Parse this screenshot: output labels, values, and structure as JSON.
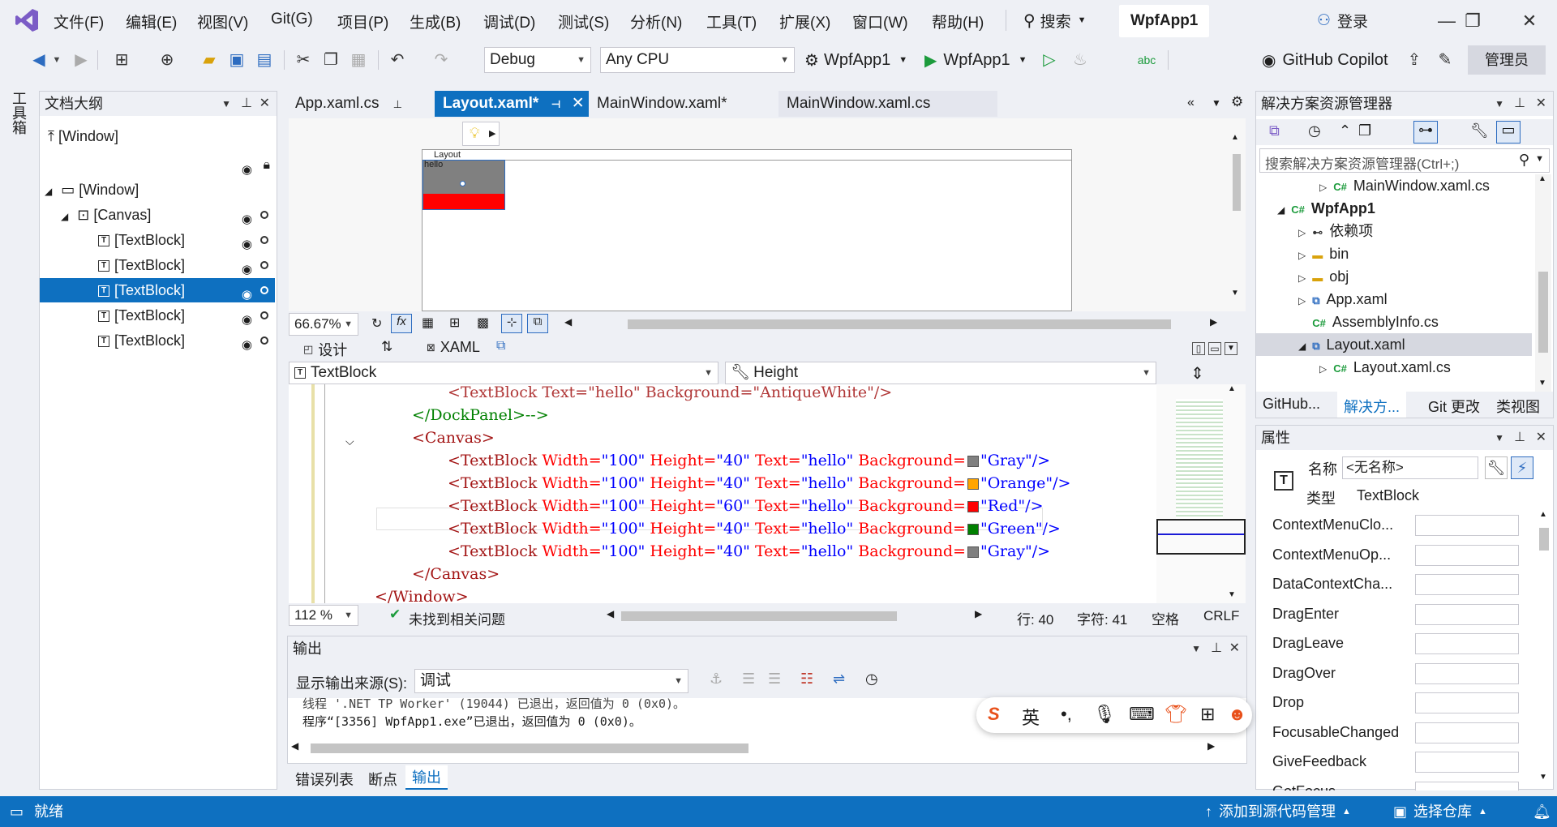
{
  "menu": {
    "items": [
      "文件(F)",
      "编辑(E)",
      "视图(V)",
      "Git(G)",
      "项目(P)",
      "生成(B)",
      "调试(D)",
      "测试(S)",
      "分析(N)",
      "工具(T)",
      "扩展(X)",
      "窗口(W)",
      "帮助(H)"
    ],
    "search_label": "搜索",
    "window_title": "WpfApp1",
    "login_label": "登录"
  },
  "toolbar": {
    "config": "Debug",
    "platform": "Any CPU",
    "startup_project": "WpfApp1",
    "run_target": "WpfApp1",
    "copilot_label": "GitHub Copilot",
    "admin_label": "管理员"
  },
  "toolbox": {
    "label": "工具箱"
  },
  "outline": {
    "title": "文档大纲",
    "top_item": "[Window]",
    "window": "[Window]",
    "canvas": "[Canvas]",
    "items": [
      "[TextBlock]",
      "[TextBlock]",
      "[TextBlock]",
      "[TextBlock]",
      "[TextBlock]"
    ]
  },
  "tabs": {
    "t1": "App.xaml.cs",
    "t2": "Layout.xaml*",
    "t3": "MainWindow.xaml*",
    "t4": "MainWindow.xaml.cs"
  },
  "designer": {
    "window_caption": "Layout",
    "block_text": "hello",
    "zoom": "66.67%",
    "design_tab": "设计",
    "xaml_tab": "XAML"
  },
  "code_nav": {
    "element": "TextBlock",
    "member": "Height"
  },
  "code": {
    "l0": "<TextBlock Text=\"hello\" Background=\"AntiqueWhite\"/>",
    "l1": "</DockPanel>-->",
    "l2": "<Canvas>",
    "rows": [
      {
        "w": "\"100\"",
        "h": "\"40\"",
        "t": "\"hello\"",
        "bg": "\"Gray\"/>",
        "color": "#808080"
      },
      {
        "w": "\"100\"",
        "h": "\"40\"",
        "t": "\"hello\"",
        "bg": "\"Orange\"/>",
        "color": "#ffa500"
      },
      {
        "w": "\"100\"",
        "h": "\"60\"",
        "t": "\"hello\"",
        "bg": "\"Red\"/>",
        "color": "#ff0000"
      },
      {
        "w": "\"100\"",
        "h": "\"40\"",
        "t": "\"hello\"",
        "bg": "\"Green\"/>",
        "color": "#008000"
      },
      {
        "w": "\"100\"",
        "h": "\"40\"",
        "t": "\"hello\"",
        "bg": "\"Gray\"/>",
        "color": "#808080"
      }
    ],
    "l8": "</Canvas>",
    "l9": "</Window>"
  },
  "editor_status": {
    "zoom": "112 %",
    "issues": "未找到相关问题",
    "line": "行: 40",
    "col": "字符: 41",
    "spacing": "空格",
    "eol": "CRLF"
  },
  "output": {
    "title": "输出",
    "source_label": "显示输出来源(S):",
    "source_value": "调试",
    "line1": "线程 '.NET TP Worker' (19044) 已退出，返回值为 0 (0x0)。",
    "line2": "程序“[3356] WpfApp1.exe”已退出，返回值为 0 (0x0)。",
    "tabs": [
      "错误列表",
      "断点",
      "输出"
    ]
  },
  "solution": {
    "title": "解决方案资源管理器",
    "search_placeholder": "搜索解决方案资源管理器(Ctrl+;)",
    "items": [
      {
        "label": "MainWindow.xaml.cs",
        "indent": 3
      },
      {
        "label": "WpfApp1",
        "indent": 1
      },
      {
        "label": "依赖项",
        "indent": 2
      },
      {
        "label": "bin",
        "indent": 2
      },
      {
        "label": "obj",
        "indent": 2
      },
      {
        "label": "App.xaml",
        "indent": 2
      },
      {
        "label": "AssemblyInfo.cs",
        "indent": 2
      },
      {
        "label": "Layout.xaml",
        "indent": 2
      },
      {
        "label": "Layout.xaml.cs",
        "indent": 3
      }
    ],
    "bottom_tabs": [
      "GitHub...",
      "解决方...",
      "Git 更改",
      "类视图"
    ]
  },
  "properties": {
    "title": "属性",
    "name_label": "名称",
    "name_value": "<无名称>",
    "type_label": "类型",
    "type_value": "TextBlock",
    "events": [
      "ContextMenuClo...",
      "ContextMenuOp...",
      "DataContextCha...",
      "DragEnter",
      "DragLeave",
      "DragOver",
      "Drop",
      "FocusableChanged",
      "GiveFeedback",
      "GotFocus"
    ]
  },
  "status": {
    "ready": "就绪",
    "source_control": "添加到源代码管理",
    "repo": "选择仓库"
  },
  "ime": {
    "lang": "英"
  }
}
